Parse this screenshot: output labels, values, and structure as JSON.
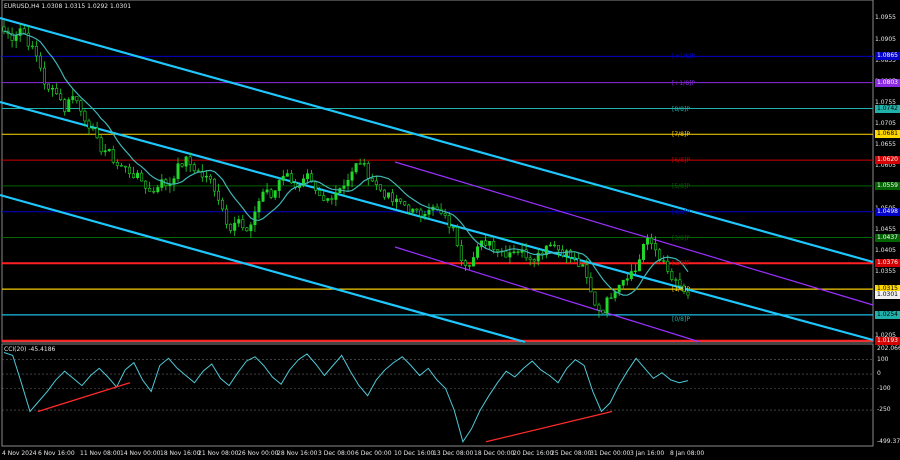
{
  "header": {
    "symbol_line": "EURUSD,H4  1.0308 1.0315 1.0292 1.0301",
    "indicator_line": "CCI(20) -45.4186"
  },
  "price_axis": {
    "labels": [
      "1.0955",
      "1.0905",
      "1.0855",
      "1.0805",
      "1.0755",
      "1.0705",
      "1.0655",
      "1.0605",
      "1.0555",
      "1.0505",
      "1.0455",
      "1.0405",
      "1.0355",
      "1.0315",
      "1.0301",
      "1.0254",
      "1.0205"
    ],
    "marker_boxes": [
      {
        "value": "1.0865",
        "color": "#0000c8"
      },
      {
        "value": "1.0803",
        "color": "#8a2be2"
      },
      {
        "value": "1.0742",
        "color": "#20b2aa"
      },
      {
        "value": "1.0681",
        "color": "#ffd700"
      },
      {
        "value": "1.0620",
        "color": "#d20000"
      },
      {
        "value": "1.0559",
        "color": "#006400"
      },
      {
        "value": "1.0498",
        "color": "#0000c8"
      },
      {
        "value": "1.0437",
        "color": "#006400"
      },
      {
        "value": "1.0376",
        "color": "#d20000"
      },
      {
        "value": "1.0315",
        "color": "#ffd700"
      },
      {
        "value": "1.0301",
        "color": "#f0f0f0"
      },
      {
        "value": "1.0254",
        "color": "#20b2aa"
      },
      {
        "value": "1.0193",
        "color": "#d20000"
      }
    ]
  },
  "murrey_labels": [
    {
      "text": "[+1/8]P",
      "color": "#0000c8"
    },
    {
      "text": "[+1/8]P",
      "color": "#8a2be2"
    },
    {
      "text": "[8/8]P",
      "color": "#20b2aa"
    },
    {
      "text": "[7/8]P",
      "color": "#ffd700"
    },
    {
      "text": "[6/8]P",
      "color": "#d20000"
    },
    {
      "text": "[5/8]P",
      "color": "#006400"
    },
    {
      "text": "[4/8]P",
      "color": "#0000c8"
    },
    {
      "text": "[3/8]P",
      "color": "#006400"
    },
    {
      "text": "[2/8]P",
      "color": "#d20000"
    },
    {
      "text": "[1/8]P",
      "color": "#ffd700"
    },
    {
      "text": "[0/8]P",
      "color": "#20b2aa"
    }
  ],
  "time_axis": [
    "4 Nov 2024",
    "6 Nov 16:00",
    "11 Nov 08:00",
    "14 Nov 00:00",
    "18 Nov 16:00",
    "21 Nov 08:00",
    "26 Nov 00:00",
    "28 Nov 16:00",
    "3 Dec 08:00",
    "6 Dec 00:00",
    "10 Dec 16:00",
    "13 Dec 08:00",
    "18 Dec 00:00",
    "20 Dec 16:00",
    "25 Dec 08:00",
    "31 Dec 00:00",
    "3 Jan 16:00",
    "8 Jan 08:00"
  ],
  "indicator_axis": [
    "202.0665",
    "100",
    "0",
    "-100",
    "-250",
    "-499.3751"
  ],
  "chart_data": {
    "type": "candlestick",
    "symbol": "EURUSD",
    "timeframe": "H4",
    "last": {
      "open": 1.0308,
      "high": 1.0315,
      "low": 1.0292,
      "close": 1.0301
    },
    "ylim": [
      1.019,
      1.097
    ],
    "close_path": [
      1.0925,
      1.091,
      1.0935,
      1.089,
      1.0855,
      1.078,
      1.079,
      1.074,
      1.078,
      1.073,
      1.07,
      1.065,
      1.064,
      1.061,
      1.06,
      1.0585,
      1.057,
      1.054,
      1.057,
      1.056,
      1.06,
      1.062,
      1.06,
      1.058,
      1.057,
      1.052,
      1.046,
      1.048,
      1.044,
      1.05,
      1.055,
      1.053,
      1.059,
      1.058,
      1.055,
      1.058,
      1.054,
      1.052,
      1.054,
      1.056,
      1.058,
      1.062,
      1.059,
      1.056,
      1.054,
      1.052,
      1.052,
      1.05,
      1.049,
      1.051,
      1.05,
      1.048,
      1.045,
      1.038,
      1.038,
      1.042,
      1.043,
      1.041,
      1.04,
      1.041,
      1.04,
      1.039,
      1.04,
      1.043,
      1.041,
      1.04,
      1.038,
      1.036,
      1.029,
      1.026,
      1.03,
      1.033,
      1.035,
      1.036,
      1.043,
      1.042,
      1.038,
      1.034,
      1.032,
      1.0301
    ],
    "murrey_levels": [
      1.0865,
      1.0803,
      1.0742,
      1.0681,
      1.062,
      1.0559,
      1.0498,
      1.0437,
      1.0376,
      1.0315,
      1.0254,
      1.0193
    ],
    "horizontal_lines": [
      1.0376,
      1.0315,
      1.0254,
      1.0193
    ],
    "indicator": {
      "name": "CCI(20)",
      "value": -45.4186,
      "ylim": [
        -499.3751,
        202.0665
      ],
      "levels": [
        100,
        0,
        -100,
        -250
      ],
      "values": [
        150,
        130,
        -60,
        -260,
        -190,
        -120,
        -40,
        20,
        -30,
        -80,
        -10,
        40,
        -20,
        -90,
        30,
        80,
        -40,
        -120,
        60,
        110,
        40,
        -10,
        -60,
        20,
        70,
        -30,
        -80,
        10,
        90,
        120,
        60,
        -20,
        -70,
        30,
        100,
        140,
        70,
        -10,
        60,
        130,
        20,
        -80,
        -150,
        -40,
        30,
        80,
        120,
        60,
        -10,
        40,
        -40,
        -100,
        -250,
        -470,
        -380,
        -250,
        -150,
        -60,
        20,
        -20,
        40,
        90,
        30,
        -10,
        -60,
        40,
        100,
        60,
        -120,
        -260,
        -200,
        -80,
        20,
        110,
        40,
        -30,
        10,
        -40,
        -60,
        -45.4186
      ]
    }
  },
  "colors": {
    "background": "#000000",
    "candle": "#22d62a",
    "channel": "#1ec8ff",
    "moving_average": "#3fb6b6",
    "purple_channel": "#9b30ff",
    "divergence": "#ff2a2a"
  }
}
